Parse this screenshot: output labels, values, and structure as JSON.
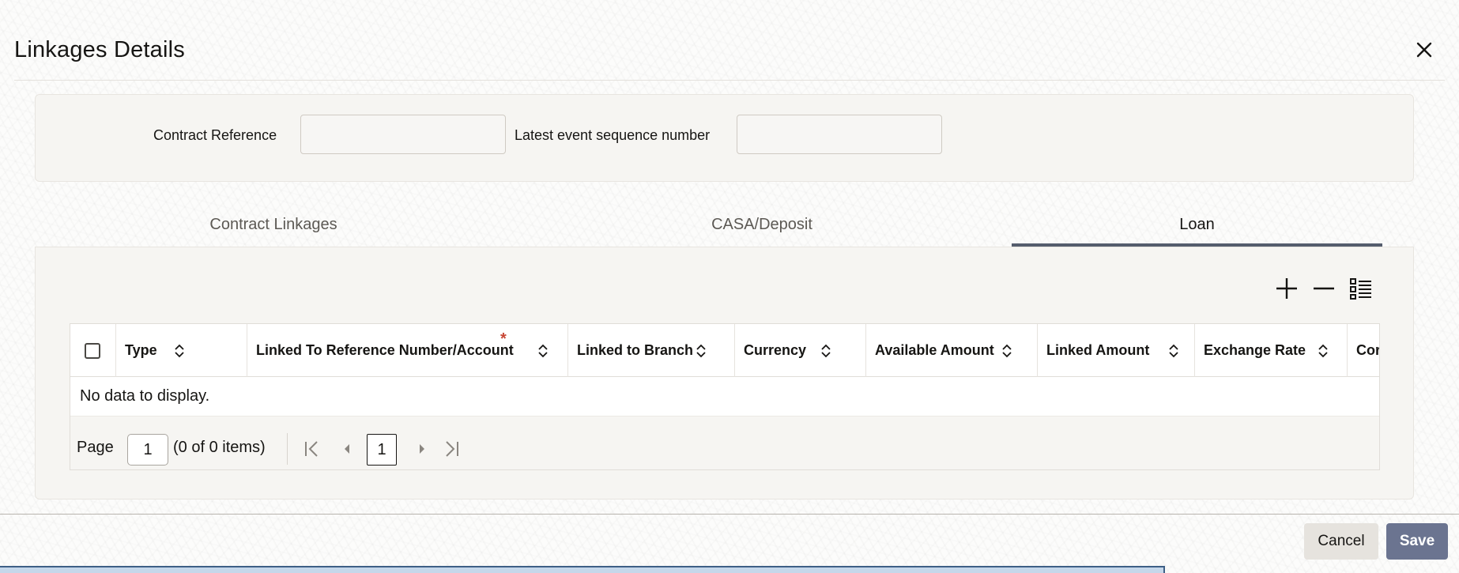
{
  "dialog": {
    "title": "Linkages Details",
    "close_icon": "close-icon"
  },
  "form": {
    "contract_reference_label": "Contract Reference",
    "contract_reference_value": "",
    "latest_event_label": "Latest event sequence number",
    "latest_event_value": ""
  },
  "tabs": [
    {
      "label": "Contract Linkages",
      "active": false
    },
    {
      "label": "CASA/Deposit",
      "active": false
    },
    {
      "label": "Loan",
      "active": true
    }
  ],
  "toolbar": {
    "add_icon": "plus-icon",
    "remove_icon": "minus-icon",
    "columns_icon": "list-icon"
  },
  "grid": {
    "columns": [
      {
        "label": "Type",
        "required": false
      },
      {
        "label": "Linked To Reference Number/Account",
        "required": true
      },
      {
        "label": "Linked to Branch",
        "required": false
      },
      {
        "label": "Currency",
        "required": false
      },
      {
        "label": "Available Amount",
        "required": false
      },
      {
        "label": "Linked Amount",
        "required": false
      },
      {
        "label": "Exchange Rate",
        "required": false
      },
      {
        "label": "Cor",
        "required": false
      }
    ],
    "required_marker": "*",
    "empty_message": "No data to display.",
    "pager": {
      "page_label": "Page",
      "page_value": "1",
      "items_text": "(0 of 0 items)",
      "current_page": "1"
    }
  },
  "footer": {
    "cancel_label": "Cancel",
    "save_label": "Save"
  },
  "colors": {
    "accent": "#6b7490",
    "tab_underline": "#555d6d",
    "required": "#c74634"
  }
}
